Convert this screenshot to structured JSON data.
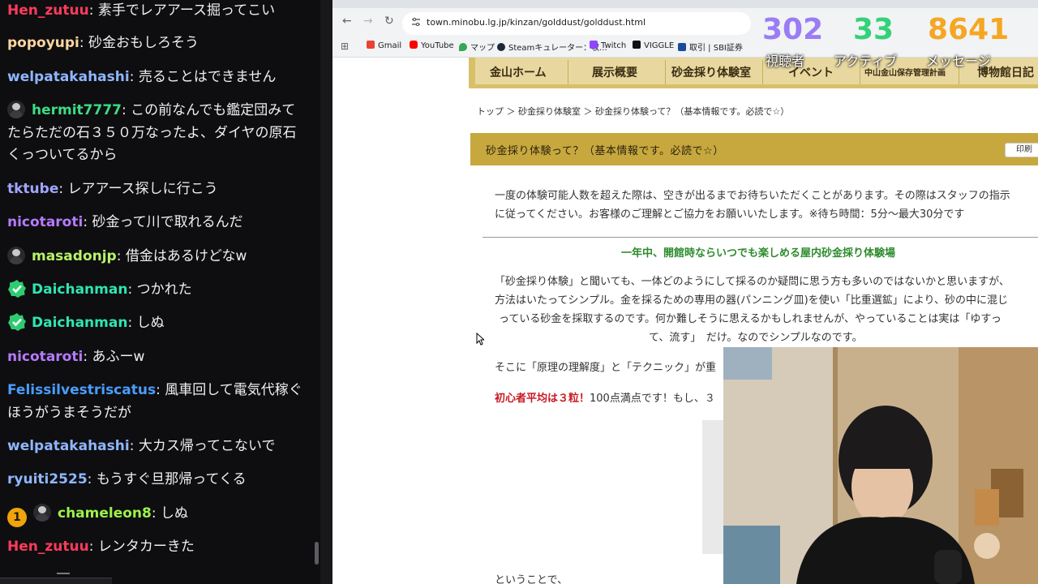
{
  "chat": {
    "messages": [
      {
        "user": "Hen_zutuu",
        "color": "#ff3b5c",
        "text": "素手でレアアース掘ってこい"
      },
      {
        "user": "popoyupi",
        "color": "#ffd6a0",
        "text": "砂金おもしろそう"
      },
      {
        "user": "welpatakahashi",
        "color": "#8fb6ff",
        "text": "売ることはできません"
      },
      {
        "user": "hermit7777",
        "color": "#3ddc84",
        "text": "この前なんでも鑑定団みてたらただの石３５０万なったよ、ダイヤの原石くっついてるから",
        "badges": [
          "avatar"
        ]
      },
      {
        "user": "tktube",
        "color": "#a0a6ff",
        "text": "レアアース探しに行こう"
      },
      {
        "user": "nicotaroti",
        "color": "#b57bff",
        "text": "砂金って川で取れるんだ"
      },
      {
        "user": "masadonjp",
        "color": "#b9f26b",
        "text": "借金はあるけどなw",
        "badges": [
          "avatar"
        ]
      },
      {
        "user": "Daichanman",
        "color": "#2ee6b0",
        "text": "つかれた",
        "badges": [
          "verified"
        ]
      },
      {
        "user": "Daichanman",
        "color": "#2ee6b0",
        "text": "しぬ",
        "badges": [
          "verified"
        ]
      },
      {
        "user": "nicotaroti",
        "color": "#b57bff",
        "text": "あふーw"
      },
      {
        "user": "Felissilvestriscatus",
        "color": "#4a9dff",
        "text": "風車回して電気代稼ぐほうがうまそうだが"
      },
      {
        "user": "welpatakahashi",
        "color": "#8fb6ff",
        "text": "大カス帰ってこないで"
      },
      {
        "user": "ryuiti2525",
        "color": "#8fb6ff",
        "text": "もうすぐ旦那帰ってくる"
      },
      {
        "user": "chameleon8",
        "color": "#9df24a",
        "text": "しぬ",
        "badges": [
          "sub-1",
          "avatar"
        ]
      },
      {
        "user": "Hen_zutuu",
        "color": "#ff3b5c",
        "text": "レンタカーきた"
      }
    ]
  },
  "browser": {
    "url": "town.minobu.lg.jp/kinzan/golddust/golddust.html",
    "bookmarks": [
      "Gmail",
      "YouTube",
      "マップ",
      "Steamキュレーター：収...",
      "Twitch",
      "VIGGLE",
      "取引 | SBI証券"
    ]
  },
  "site": {
    "nav": [
      "金山ホーム",
      "展示概要",
      "砂金採り体験室",
      "イベント",
      "中山金山保存管理計画",
      "博物館日記"
    ],
    "breadcrumb": "トップ ＞ 砂金採り体験室 ＞ 砂金採り体験って？（基本情報です。必読で☆）",
    "title": "砂金採り体験って？（基本情報です。必読で☆）",
    "print_label": "印刷",
    "para1_line1": "一度の体験可能人数を超えた際は、空きが出るまでお待ちいただくことがあります。その際はスタッフの指示",
    "para1_line2": "に従ってください。お客様のご理解とご協力をお願いいたします。※待ち時間：5分～最大30分です",
    "subheading": "一年中、開館時ならいつでも楽しめる屋内砂金採り体験場",
    "para2_line1": "「砂金採り体験」と聞いても、一体どのようにして採るのか疑問に思う方も多いのではないかと思いますが、",
    "para2_line2": "方法はいたってシンプル。金を採るための専用の器(パンニング皿)を使い「比重選鉱」により、砂の中に混じ",
    "para2_line3": "っている砂金を採取するのです。何か難しそうに思えるかもしれませんが、やっていることは実は「ゆすっ",
    "para2_line4": "て、流す」　だけ。なのでシンプルなのです。",
    "para3": "そこに「原理の理解度」と「テクニック」が重",
    "para4_strong": "初心者平均は３粒！",
    "para4_rest": "100点満点です！もし、３",
    "para5": "ということで、"
  },
  "stats": [
    {
      "value": "302",
      "label": "視聴者",
      "color": "#9b7cf5"
    },
    {
      "value": "33",
      "label": "アクティブ",
      "color": "#33d17a"
    },
    {
      "value": "8641",
      "label": "メッセージ",
      "color": "#f5a623"
    }
  ]
}
